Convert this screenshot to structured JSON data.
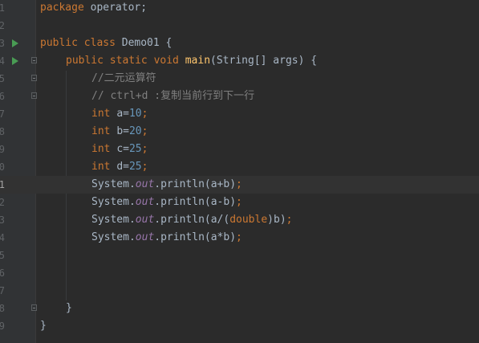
{
  "editor": {
    "current_line_index": 10,
    "lines": [
      {
        "number": "1",
        "run": false,
        "fold": false,
        "indent": 0,
        "tokens": [
          {
            "t": "kw",
            "v": "package "
          },
          {
            "t": "id",
            "v": "operator;"
          }
        ]
      },
      {
        "number": "2",
        "run": false,
        "fold": false,
        "indent": 0,
        "tokens": []
      },
      {
        "number": "3",
        "run": true,
        "fold": false,
        "indent": 0,
        "tokens": [
          {
            "t": "kw",
            "v": "public class "
          },
          {
            "t": "id",
            "v": "Demo01 {"
          }
        ]
      },
      {
        "number": "4",
        "run": true,
        "fold": true,
        "indent": 1,
        "tokens": [
          {
            "t": "kw",
            "v": "public static void "
          },
          {
            "t": "fn",
            "v": "main"
          },
          {
            "t": "id",
            "v": "(String[] args) {"
          }
        ]
      },
      {
        "number": "5",
        "run": false,
        "fold": true,
        "indent": 2,
        "tokens": [
          {
            "t": "cmt",
            "v": "//二元运算符"
          }
        ]
      },
      {
        "number": "6",
        "run": false,
        "fold": true,
        "indent": 2,
        "tokens": [
          {
            "t": "cmt",
            "v": "// ctrl+d :复制当前行到下一行"
          }
        ]
      },
      {
        "number": "7",
        "run": false,
        "fold": false,
        "indent": 2,
        "tokens": [
          {
            "t": "kw",
            "v": "int "
          },
          {
            "t": "id",
            "v": "a="
          },
          {
            "t": "num",
            "v": "10"
          },
          {
            "t": "kw",
            "v": ";"
          }
        ]
      },
      {
        "number": "8",
        "run": false,
        "fold": false,
        "indent": 2,
        "tokens": [
          {
            "t": "kw",
            "v": "int "
          },
          {
            "t": "id",
            "v": "b="
          },
          {
            "t": "num",
            "v": "20"
          },
          {
            "t": "kw",
            "v": ";"
          }
        ]
      },
      {
        "number": "9",
        "run": false,
        "fold": false,
        "indent": 2,
        "tokens": [
          {
            "t": "kw",
            "v": "int "
          },
          {
            "t": "id",
            "v": "c="
          },
          {
            "t": "num",
            "v": "25"
          },
          {
            "t": "kw",
            "v": ";"
          }
        ]
      },
      {
        "number": "10",
        "run": false,
        "fold": false,
        "indent": 2,
        "tokens": [
          {
            "t": "kw",
            "v": "int "
          },
          {
            "t": "id",
            "v": "d="
          },
          {
            "t": "num",
            "v": "25"
          },
          {
            "t": "kw",
            "v": ";"
          }
        ]
      },
      {
        "number": "11",
        "run": false,
        "fold": false,
        "indent": 2,
        "tokens": [
          {
            "t": "id",
            "v": "System."
          },
          {
            "t": "fld",
            "v": "out"
          },
          {
            "t": "id",
            "v": ".println(a+b)"
          },
          {
            "t": "kw",
            "v": ";"
          }
        ]
      },
      {
        "number": "12",
        "run": false,
        "fold": false,
        "indent": 2,
        "tokens": [
          {
            "t": "id",
            "v": "System."
          },
          {
            "t": "fld",
            "v": "out"
          },
          {
            "t": "id",
            "v": ".println(a-b)"
          },
          {
            "t": "kw",
            "v": ";"
          }
        ]
      },
      {
        "number": "13",
        "run": false,
        "fold": false,
        "indent": 2,
        "tokens": [
          {
            "t": "id",
            "v": "System."
          },
          {
            "t": "fld",
            "v": "out"
          },
          {
            "t": "id",
            "v": ".println(a/("
          },
          {
            "t": "kw",
            "v": "double"
          },
          {
            "t": "id",
            "v": ")b)"
          },
          {
            "t": "kw",
            "v": ";"
          }
        ]
      },
      {
        "number": "14",
        "run": false,
        "fold": false,
        "indent": 2,
        "tokens": [
          {
            "t": "id",
            "v": "System."
          },
          {
            "t": "fld",
            "v": "out"
          },
          {
            "t": "id",
            "v": ".println(a*b)"
          },
          {
            "t": "kw",
            "v": ";"
          }
        ]
      },
      {
        "number": "15",
        "run": false,
        "fold": false,
        "indent": 0,
        "tokens": []
      },
      {
        "number": "16",
        "run": false,
        "fold": false,
        "indent": 0,
        "tokens": []
      },
      {
        "number": "17",
        "run": false,
        "fold": false,
        "indent": 0,
        "tokens": []
      },
      {
        "number": "18",
        "run": false,
        "fold": true,
        "indent": 1,
        "tokens": [
          {
            "t": "id",
            "v": "}"
          }
        ]
      },
      {
        "number": "19",
        "run": false,
        "fold": false,
        "indent": 0,
        "tokens": [
          {
            "t": "id",
            "v": "}"
          }
        ]
      }
    ]
  },
  "colors": {
    "background": "#2b2b2b",
    "gutter": "#313335",
    "keyword": "#cc7832",
    "method": "#ffc66d",
    "number": "#6897bb",
    "comment": "#808080",
    "field": "#9876aa",
    "text": "#a9b7c6",
    "run_icon": "#499c54",
    "current_line": "#323232"
  }
}
